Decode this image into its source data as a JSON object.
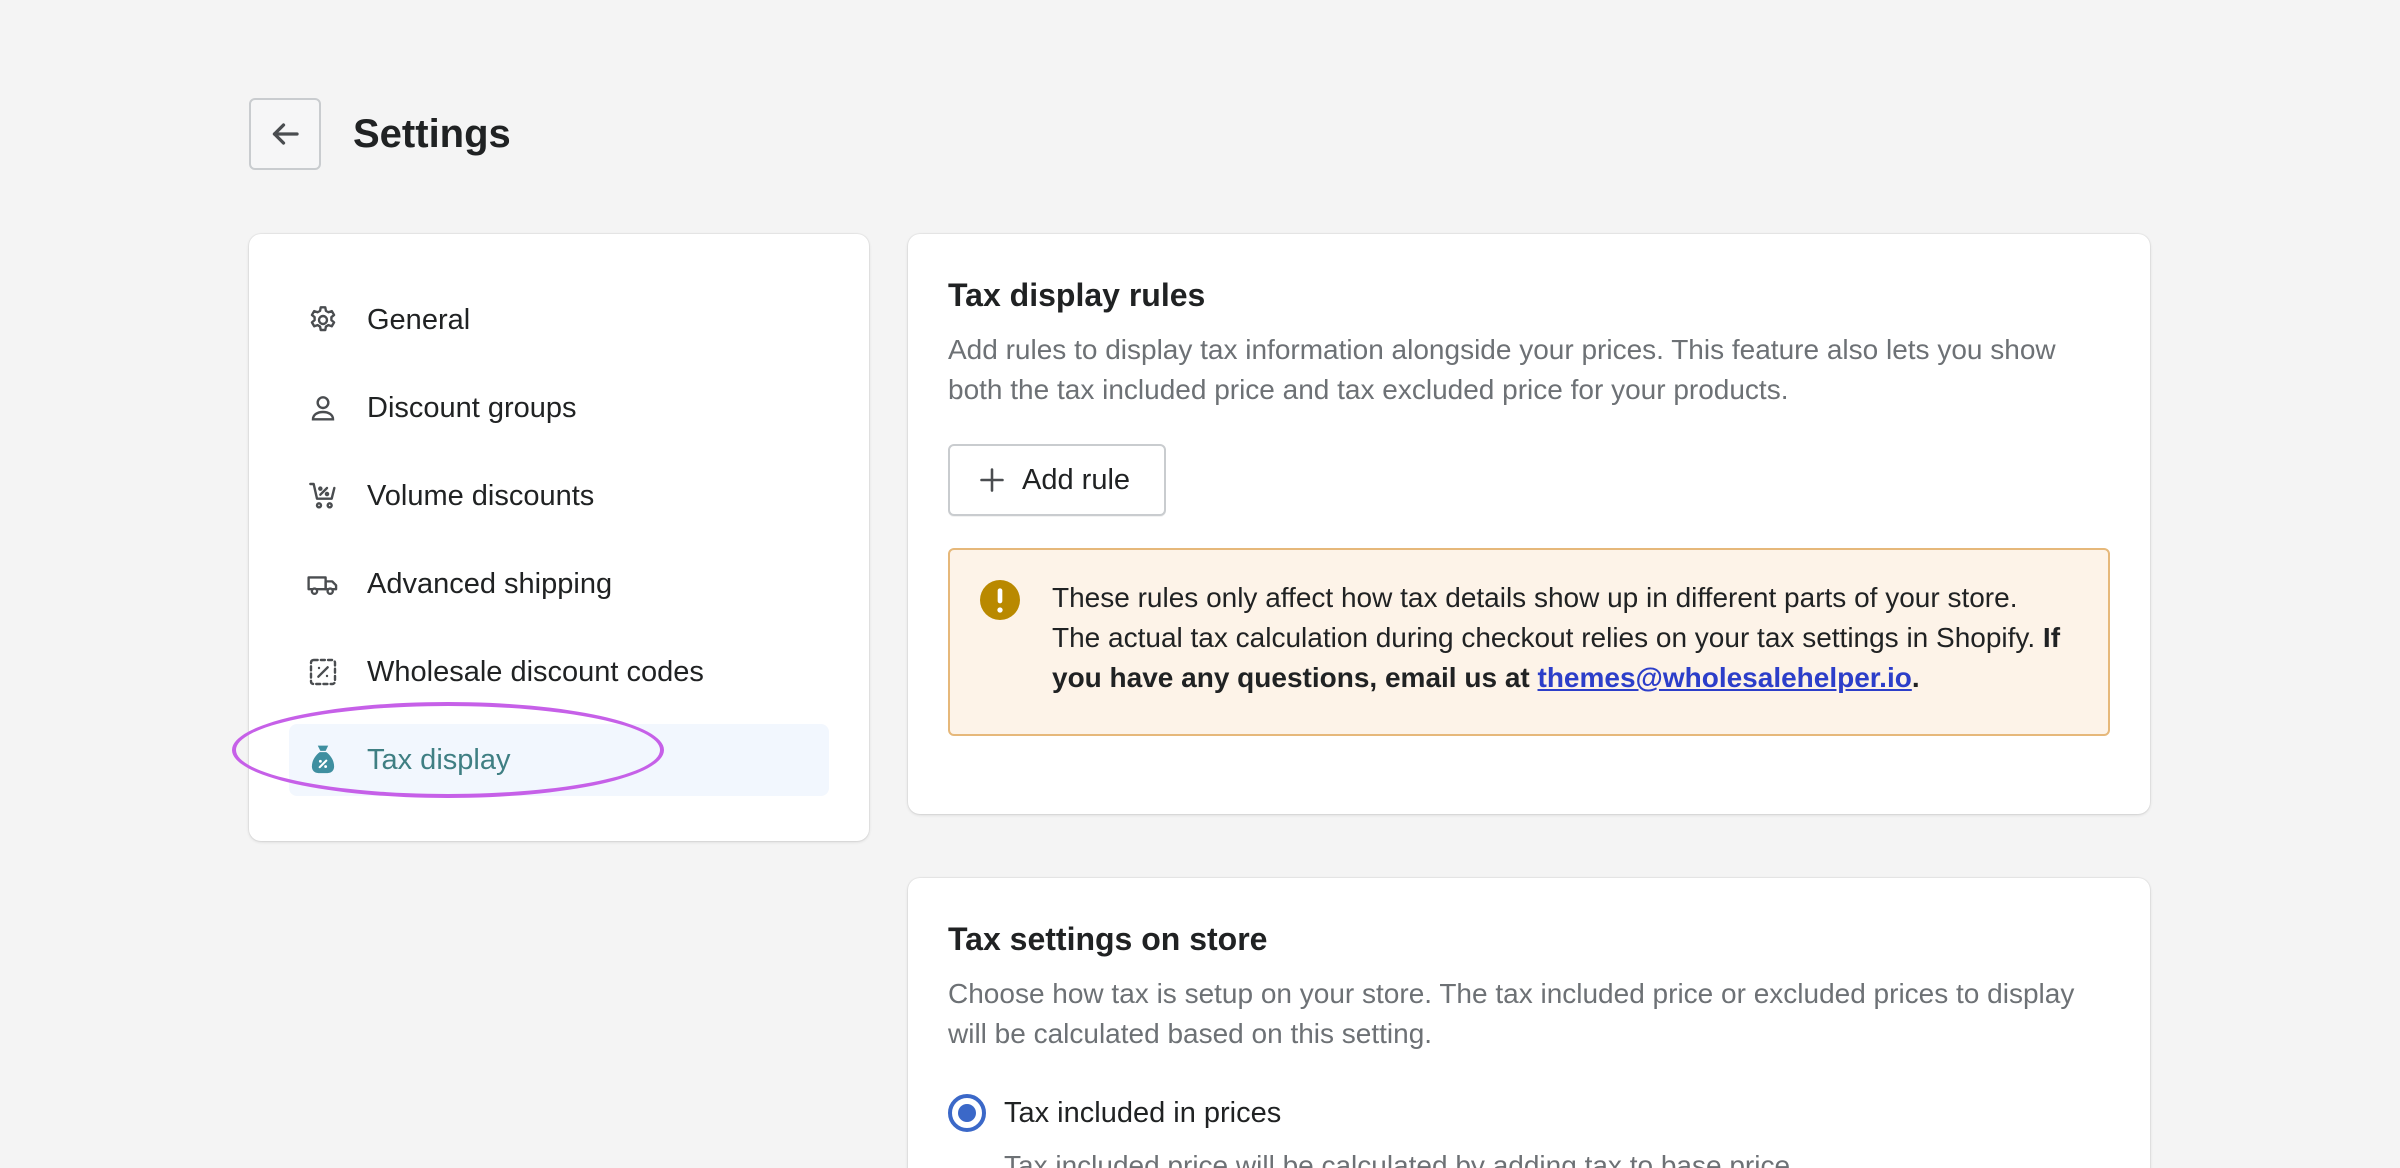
{
  "header": {
    "title": "Settings",
    "back_icon": "arrow-left-icon"
  },
  "sidebar": {
    "items": [
      {
        "label": "General",
        "icon": "gear-icon",
        "active": false
      },
      {
        "label": "Discount groups",
        "icon": "person-icon",
        "active": false
      },
      {
        "label": "Volume discounts",
        "icon": "cart-discount-icon",
        "active": false
      },
      {
        "label": "Advanced shipping",
        "icon": "truck-icon",
        "active": false
      },
      {
        "label": "Wholesale discount codes",
        "icon": "discount-code-icon",
        "active": false
      },
      {
        "label": "Tax display",
        "icon": "tax-bag-icon",
        "active": true
      }
    ],
    "active_color": "#3f7f83",
    "highlight_color": "#c660e8"
  },
  "tax_display_rules": {
    "title": "Tax display rules",
    "description": "Add rules to display tax information alongside your prices. This feature also lets you show both the tax included price and tax excluded price for your products.",
    "add_rule_label": "Add rule",
    "banner": {
      "text": "These rules only affect how tax details show up in different parts of your store. The actual tax calculation during checkout relies on your tax settings in Shopify.",
      "bold_text": "If you have any questions, email us at",
      "email": "themes@wholesalehelper.io",
      "end": ".",
      "icon": "warning-icon",
      "background": "#fdf3e8",
      "border": "#e6b87a"
    }
  },
  "tax_settings": {
    "title": "Tax settings on store",
    "description": "Choose how tax is setup on your store. The tax included price or excluded prices to display will be calculated based on this setting.",
    "options": [
      {
        "label": "Tax included in prices",
        "help": "Tax included price will be calculated by adding tax to base price.",
        "selected": true
      }
    ],
    "radio_color": "#3b68c8"
  }
}
